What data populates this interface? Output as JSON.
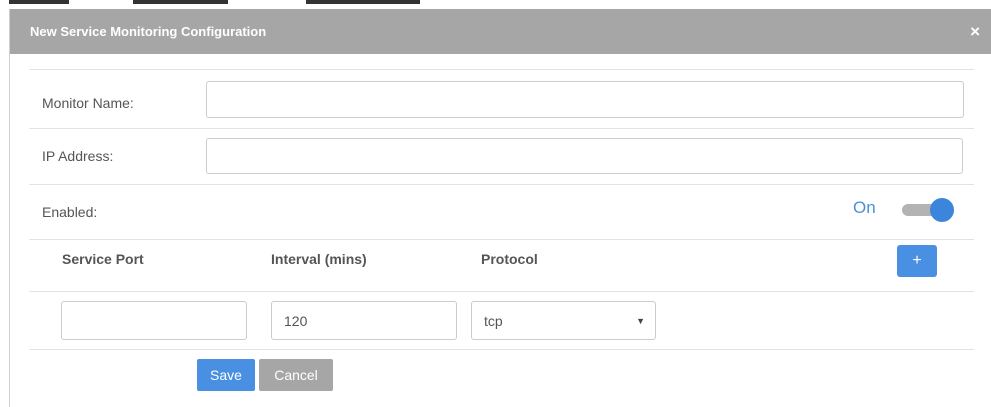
{
  "modal": {
    "title": "New Service Monitoring Configuration",
    "close_glyph": "×"
  },
  "form": {
    "monitor_name": {
      "label": "Monitor Name:",
      "value": ""
    },
    "ip_address": {
      "label": "IP Address:",
      "value": ""
    },
    "enabled": {
      "label": "Enabled:",
      "state_text": "On",
      "on": true
    }
  },
  "services": {
    "headers": [
      "Service Port",
      "Interval (mins)",
      "Protocol"
    ],
    "add_label": "+",
    "rows": [
      {
        "port": "",
        "interval": "120",
        "protocol": "tcp"
      }
    ]
  },
  "actions": {
    "save_label": "Save",
    "cancel_label": "Cancel"
  },
  "colors": {
    "header_bg": "#a6a6a6",
    "accent": "#4a90e2",
    "toggle_on": "#3b86dc"
  },
  "icons": {
    "close": "close-icon",
    "plus": "plus-icon",
    "dropdown": "chevron-down-icon"
  }
}
